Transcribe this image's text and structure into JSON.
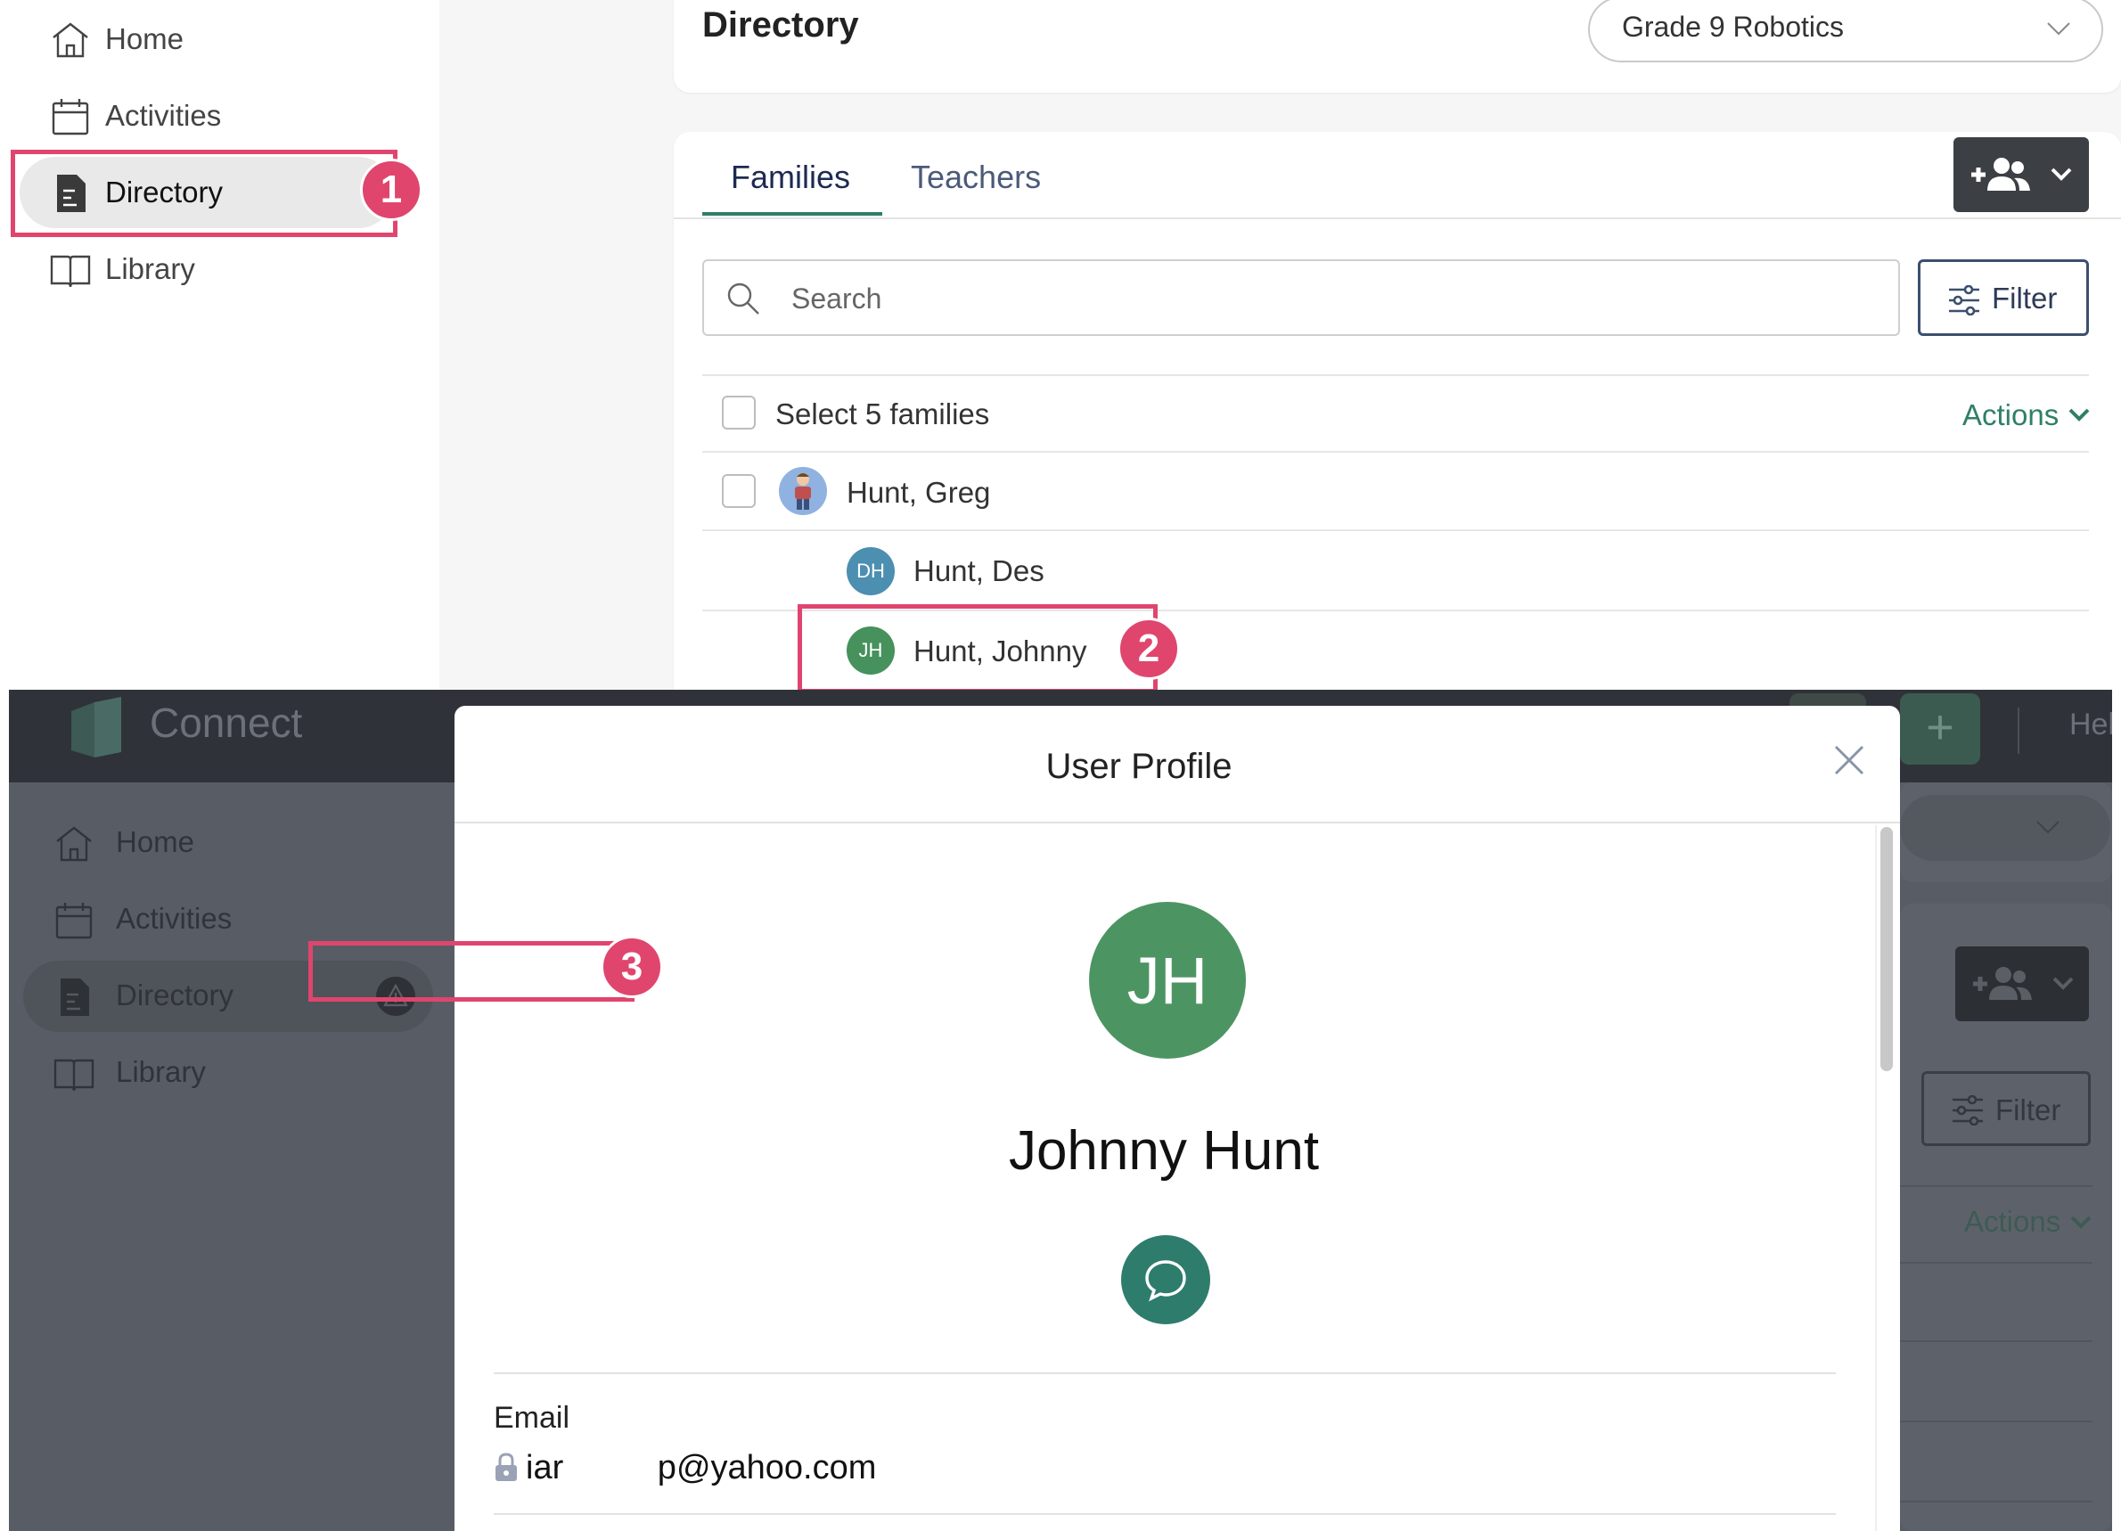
{
  "top": {
    "sidebar": {
      "items": [
        {
          "label": "Home",
          "icon": "home-icon"
        },
        {
          "label": "Activities",
          "icon": "calendar-icon"
        },
        {
          "label": "Directory",
          "icon": "document-icon",
          "active": true
        },
        {
          "label": "Library",
          "icon": "book-icon"
        }
      ]
    },
    "page_title": "Directory",
    "class_select": {
      "value": "Grade 9 Robotics"
    },
    "tabs": [
      {
        "label": "Families",
        "active": true
      },
      {
        "label": "Teachers",
        "active": false
      }
    ],
    "search": {
      "placeholder": "Search"
    },
    "filter_label": "Filter",
    "select_all_label": "Select 5 families",
    "actions_label": "Actions",
    "families": [
      {
        "name": "Hunt, Greg"
      },
      {
        "name": "Hunt, Des",
        "initials": "DH"
      },
      {
        "name": "Hunt, Johnny",
        "initials": "JH"
      }
    ]
  },
  "callouts": [
    "1",
    "2",
    "3"
  ],
  "bottom": {
    "app_name": "Connect",
    "header_help": "Hel",
    "header_plus": "+",
    "sidebar": {
      "items": [
        {
          "label": "Home"
        },
        {
          "label": "Activities"
        },
        {
          "label": "Directory",
          "active": true
        },
        {
          "label": "Library"
        }
      ]
    },
    "filter_label": "Filter",
    "actions_label": "Actions",
    "modal": {
      "title": "User Profile",
      "initials": "JH",
      "name": "Johnny Hunt",
      "email_label": "Email",
      "email_value": "iar          p@yahoo.com"
    }
  },
  "colors": {
    "accent_green": "#2f7f68",
    "callout_pink": "#e0456e",
    "avatar_green": "#4c9563",
    "avatar_blue": "#4c8fb0"
  }
}
